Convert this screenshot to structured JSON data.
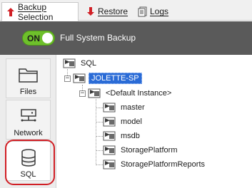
{
  "tabs": [
    {
      "label": "Backup Selection",
      "icon": "arrow-up-icon",
      "active": true
    },
    {
      "label": "Restore",
      "icon": "arrow-down-icon",
      "active": false
    },
    {
      "label": "Logs",
      "icon": "logs-icon",
      "active": false
    }
  ],
  "banner": {
    "toggle_text": "ON",
    "label": "Full System Backup"
  },
  "sidebar": {
    "items": [
      {
        "label": "Files",
        "icon": "folder-icon"
      },
      {
        "label": "Network",
        "icon": "network-icon"
      },
      {
        "label": "SQL",
        "icon": "database-icon",
        "selected": true
      }
    ]
  },
  "tree": {
    "root": "SQL",
    "server": "JOLETTE-SP",
    "instance": "<Default Instance>",
    "databases": [
      "master",
      "model",
      "msdb",
      "StoragePlatform",
      "StoragePlatformReports"
    ]
  },
  "colors": {
    "accent_red": "#d11f25",
    "toggle_green": "#6ec02b",
    "band_gray": "#5a5a5a",
    "selection_blue": "#2a6bd6"
  }
}
